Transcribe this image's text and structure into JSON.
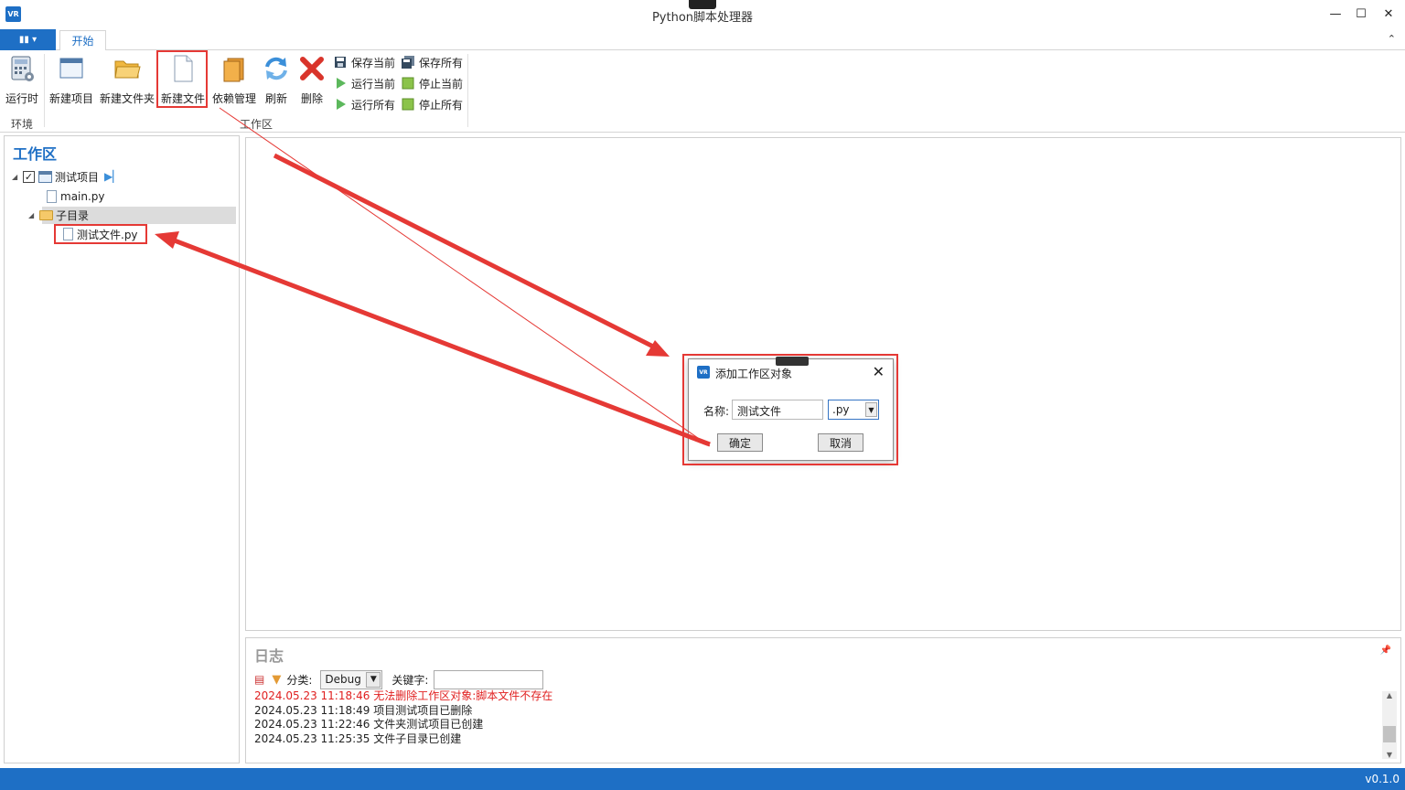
{
  "window": {
    "title": "Python脚本处理器",
    "logo_text": "VR",
    "minimize": "—",
    "maximize": "☐",
    "close": "✕"
  },
  "ribbon_tabs": {
    "app_menu": "▮▮ ▾",
    "start": "开始",
    "collapse": "⌃"
  },
  "ribbon": {
    "runtime": "运行时",
    "new_project": "新建项目",
    "new_folder": "新建文件夹",
    "new_file": "新建文件",
    "dependency": "依赖管理",
    "refresh": "刷新",
    "delete": "删除",
    "save_current": "保存当前",
    "save_all": "保存所有",
    "run_current": "运行当前",
    "stop_current": "停止当前",
    "run_all": "运行所有",
    "stop_all": "停止所有",
    "group_env": "环境",
    "group_workspace": "工作区"
  },
  "workspace": {
    "title": "工作区",
    "project": "测试项目",
    "file_main": "main.py",
    "folder": "子目录",
    "file_test": "测试文件.py"
  },
  "log": {
    "title": "日志",
    "category_label": "分类:",
    "category_value": "Debug",
    "keyword_label": "关键字:",
    "lines": [
      "2024.05.23 11:18:46 无法删除工作区对象:脚本文件不存在",
      "2024.05.23 11:18:49 项目测试项目已删除",
      "2024.05.23 11:22:46 文件夹测试项目已创建",
      "2024.05.23 11:25:35 文件子目录已创建"
    ]
  },
  "status": {
    "version": "v0.1.0"
  },
  "dialog": {
    "title": "添加工作区对象",
    "name_label": "名称:",
    "name_value": "测试文件",
    "ext_value": ".py",
    "ok": "确定",
    "cancel": "取消"
  },
  "colors": {
    "accent": "#1e6fc5",
    "highlight": "#e53935",
    "error_text": "#e02020"
  }
}
